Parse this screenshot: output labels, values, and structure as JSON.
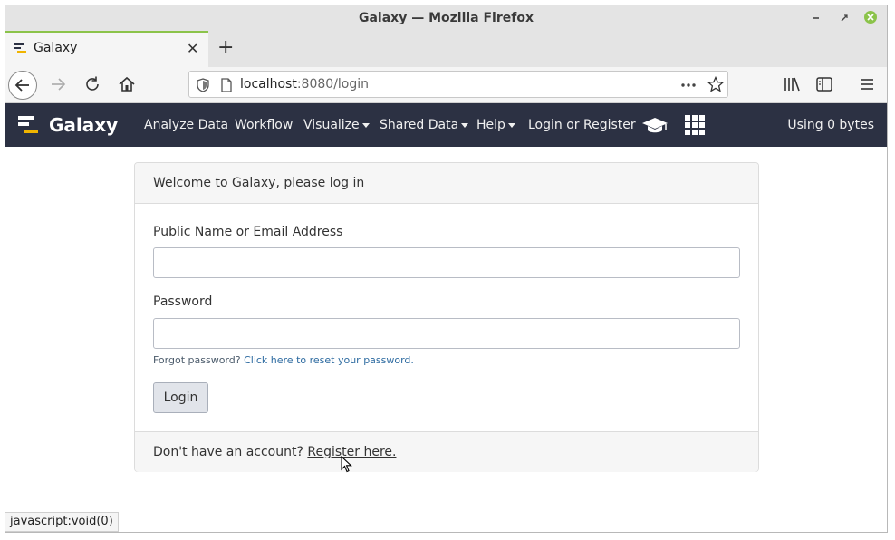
{
  "window": {
    "title": "Galaxy — Mozilla Firefox"
  },
  "tabs": [
    {
      "label": "Galaxy"
    }
  ],
  "address_bar": {
    "host": "localhost",
    "path": ":8080/login"
  },
  "galaxy_nav": {
    "brand": "Galaxy",
    "menu": [
      {
        "label": "Analyze Data"
      },
      {
        "label": "Workflow"
      },
      {
        "label": "Visualize"
      },
      {
        "label": "Shared Data"
      },
      {
        "label": "Help"
      },
      {
        "label": "Login or Register"
      }
    ],
    "usage": "Using 0 bytes"
  },
  "login_card": {
    "header": "Welcome to Galaxy, please log in",
    "username_label": "Public Name or Email Address",
    "username_value": "",
    "password_label": "Password",
    "password_value": "",
    "forgot_text": "Forgot password?",
    "forgot_link": "Click here to reset your password.",
    "login_button": "Login",
    "footer_text": "Don't have an account?",
    "footer_link": "Register here."
  },
  "status_bar": {
    "text": "javascript:void(0)"
  },
  "colors": {
    "navbar_bg": "#2c3143",
    "tab_accent": "#8bc34a"
  }
}
